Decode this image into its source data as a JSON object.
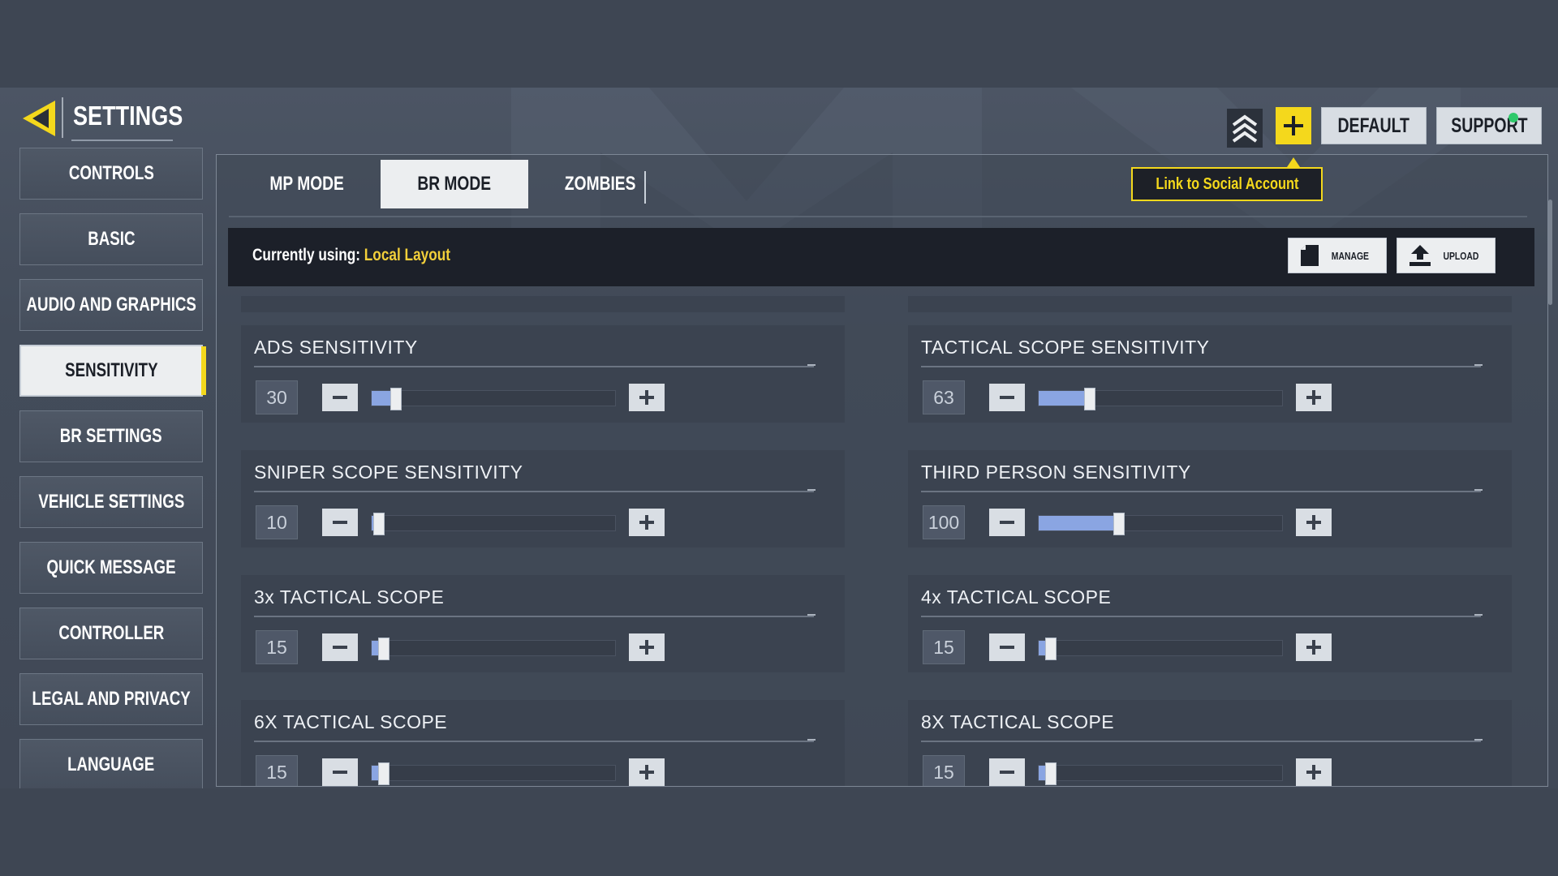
{
  "header": {
    "title": "SETTINGS"
  },
  "sidebar": {
    "items": [
      {
        "label": "CONTROLS",
        "name": "sidebar-item-controls",
        "active": false
      },
      {
        "label": "BASIC",
        "name": "sidebar-item-basic",
        "active": false
      },
      {
        "label": "AUDIO AND GRAPHICS",
        "name": "sidebar-item-audio-graphics",
        "active": false
      },
      {
        "label": "SENSITIVITY",
        "name": "sidebar-item-sensitivity",
        "active": true
      },
      {
        "label": "BR SETTINGS",
        "name": "sidebar-item-br-settings",
        "active": false
      },
      {
        "label": "VEHICLE SETTINGS",
        "name": "sidebar-item-vehicle-settings",
        "active": false
      },
      {
        "label": "QUICK MESSAGE",
        "name": "sidebar-item-quick-message",
        "active": false
      },
      {
        "label": "CONTROLLER",
        "name": "sidebar-item-controller",
        "active": false
      },
      {
        "label": "LEGAL AND PRIVACY",
        "name": "sidebar-item-legal-privacy",
        "active": false
      },
      {
        "label": "LANGUAGE",
        "name": "sidebar-item-language",
        "active": false
      }
    ]
  },
  "tabs": [
    {
      "label": "MP MODE",
      "active": false
    },
    {
      "label": "BR MODE",
      "active": true
    },
    {
      "label": "ZOMBIES",
      "active": false
    }
  ],
  "top_buttons": {
    "default_label": "DEFAULT",
    "support_label": "SUPPORT"
  },
  "tooltip": {
    "text": "Link to Social Account"
  },
  "layout_bar": {
    "currently_label": "Currently using:",
    "currently_value": "Local Layout",
    "manage_label": "MANAGE",
    "upload_label": "UPLOAD"
  },
  "sensitivity": {
    "max_value": 300,
    "settings": [
      {
        "label": "ADS SENSITIVITY",
        "value": "30",
        "fill": 0.1
      },
      {
        "label": "TACTICAL SCOPE SENSITIVITY",
        "value": "63",
        "fill": 0.21
      },
      {
        "label": "SNIPER SCOPE SENSITIVITY",
        "value": "10",
        "fill": 0.03
      },
      {
        "label": "THIRD PERSON SENSITIVITY",
        "value": "100",
        "fill": 0.33
      },
      {
        "label": "3x TACTICAL SCOPE",
        "value": "15",
        "fill": 0.05
      },
      {
        "label": "4x TACTICAL SCOPE",
        "value": "15",
        "fill": 0.05
      },
      {
        "label": "6X TACTICAL SCOPE",
        "value": "15",
        "fill": 0.05
      },
      {
        "label": "8X TACTICAL SCOPE",
        "value": "15",
        "fill": 0.05
      }
    ]
  },
  "colors": {
    "accent": "#f4d81c",
    "slider_fill": "#8aa5e2",
    "status_online": "#2ec96a"
  }
}
